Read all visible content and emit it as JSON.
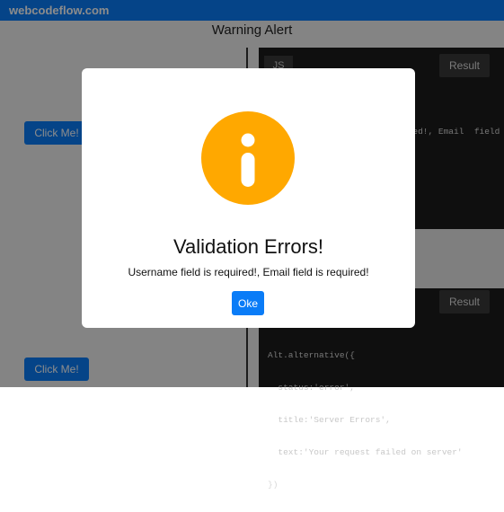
{
  "site": {
    "brand": "webcodeflow.com"
  },
  "page": {
    "title": "Warning Alert",
    "buttons": [
      "Click Me!",
      "Click Me!"
    ]
  },
  "code_panel": {
    "tab_js": "JS",
    "result_label": "Result",
    "top_snippet_fragment": "ired!, Email  field",
    "bottom_snippet": [
      "Alt.alternative({",
      "  status:'error',",
      "  title:'Server Errors',",
      "  text:'Your request failed on server'",
      "})"
    ]
  },
  "modal": {
    "icon": "info-icon",
    "icon_color": "#ffa800",
    "title": "Validation Errors!",
    "message": "Username field is required!, Email field is required!",
    "ok_label": "Oke"
  },
  "colors": {
    "brand": "#0a7cf7",
    "editor_bg": "#1d1d1d"
  }
}
